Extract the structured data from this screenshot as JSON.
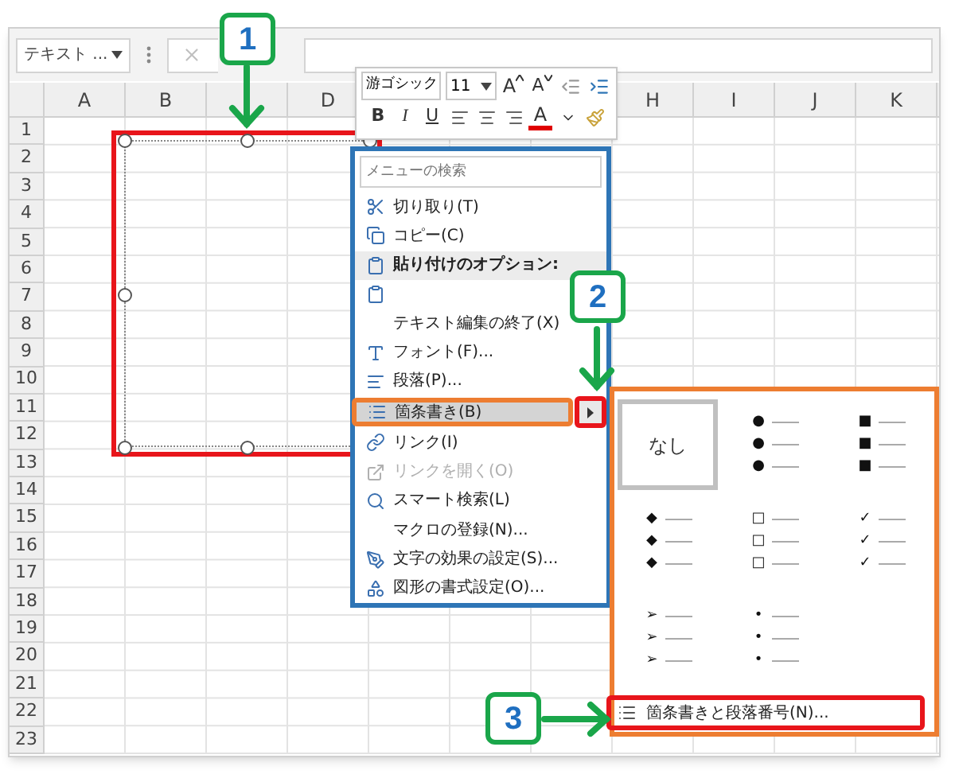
{
  "name_box": {
    "value": "テキスト ..."
  },
  "columns": [
    "A",
    "B",
    "D",
    "H",
    "I",
    "J",
    "K"
  ],
  "rows": [
    "1",
    "2",
    "3",
    "4",
    "5",
    "6",
    "7",
    "8",
    "9",
    "10",
    "11",
    "12",
    "13",
    "14",
    "15",
    "16",
    "17",
    "18",
    "19",
    "20",
    "21",
    "22",
    "23"
  ],
  "mini_toolbar": {
    "font": "游ゴシック",
    "size": "11",
    "row1": [
      {
        "kind": "grow",
        "label": "A"
      },
      {
        "kind": "shrink",
        "label": "A"
      },
      {
        "kind": "outdent"
      },
      {
        "kind": "indent"
      }
    ],
    "row2": [
      {
        "kind": "bold",
        "label": "B"
      },
      {
        "kind": "italic",
        "label": "I"
      },
      {
        "kind": "underline",
        "label": "U"
      },
      {
        "kind": "align_left"
      },
      {
        "kind": "align_center"
      },
      {
        "kind": "align_right"
      },
      {
        "kind": "font_color",
        "label": "A"
      },
      {
        "kind": "dropdown"
      },
      {
        "kind": "painter"
      }
    ]
  },
  "context_menu": {
    "search": {
      "placeholder": "メニューの検索"
    },
    "items": [
      {
        "kind": "item",
        "label": "切り取り(T)",
        "disabled": false,
        "highlighted": false,
        "submenu": false
      },
      {
        "kind": "item",
        "label": "コピー(C)",
        "disabled": false,
        "highlighted": false,
        "submenu": false
      },
      {
        "kind": "header",
        "label": "貼り付けのオプション:",
        "disabled": false,
        "highlighted": false,
        "submenu": false
      },
      {
        "kind": "paste_option",
        "disabled": false,
        "highlighted": false,
        "submenu": false
      },
      {
        "kind": "item",
        "label": "テキスト編集の終了(X)",
        "disabled": false,
        "highlighted": false,
        "submenu": false
      },
      {
        "kind": "item",
        "label": "フォント(F)...",
        "disabled": false,
        "highlighted": false,
        "submenu": false
      },
      {
        "kind": "item",
        "label": "段落(P)...",
        "disabled": false,
        "highlighted": false,
        "submenu": false
      },
      {
        "kind": "item",
        "label": "箇条書き(B)",
        "disabled": false,
        "highlighted": true,
        "submenu": true
      },
      {
        "kind": "item",
        "label": "リンク(I)",
        "disabled": false,
        "highlighted": false,
        "submenu": false
      },
      {
        "kind": "item",
        "label": "リンクを開く(O)",
        "disabled": true,
        "highlighted": false,
        "submenu": false
      },
      {
        "kind": "item",
        "label": "スマート検索(L)",
        "disabled": false,
        "highlighted": false,
        "submenu": false
      },
      {
        "kind": "item",
        "label": "マクロの登録(N)...",
        "disabled": false,
        "highlighted": false,
        "submenu": false
      },
      {
        "kind": "item",
        "label": "文字の効果の設定(S)...",
        "disabled": false,
        "highlighted": false,
        "submenu": false
      },
      {
        "kind": "item",
        "label": "図形の書式設定(O)...",
        "disabled": false,
        "highlighted": false,
        "submenu": false
      }
    ]
  },
  "bullet_menu": {
    "styles": [
      {
        "kind": "none",
        "label": "なし",
        "selected": true
      },
      {
        "kind": "symbols",
        "lines": [
          "●",
          "●",
          "●"
        ],
        "selected": false
      },
      {
        "kind": "symbols",
        "lines": [
          "■",
          "■",
          "■"
        ],
        "selected": false
      },
      {
        "kind": "symbols",
        "lines": [
          "◆",
          "◆",
          "◆"
        ],
        "selected": false
      },
      {
        "kind": "symbols",
        "lines": [
          "□",
          "□",
          "□"
        ],
        "selected": false
      },
      {
        "kind": "symbols",
        "lines": [
          "✓",
          "✓",
          "✓"
        ],
        "selected": false
      },
      {
        "kind": "symbols",
        "lines": [
          "➢",
          "➢",
          "➢"
        ],
        "selected": false
      },
      {
        "kind": "symbols",
        "lines": [
          "•",
          "•",
          "•"
        ],
        "selected": false
      }
    ],
    "footer": {
      "label": "箇条書きと段落番号(N)..."
    }
  },
  "callouts": [
    {
      "number": "1"
    },
    {
      "number": "2"
    },
    {
      "number": "3"
    }
  ]
}
